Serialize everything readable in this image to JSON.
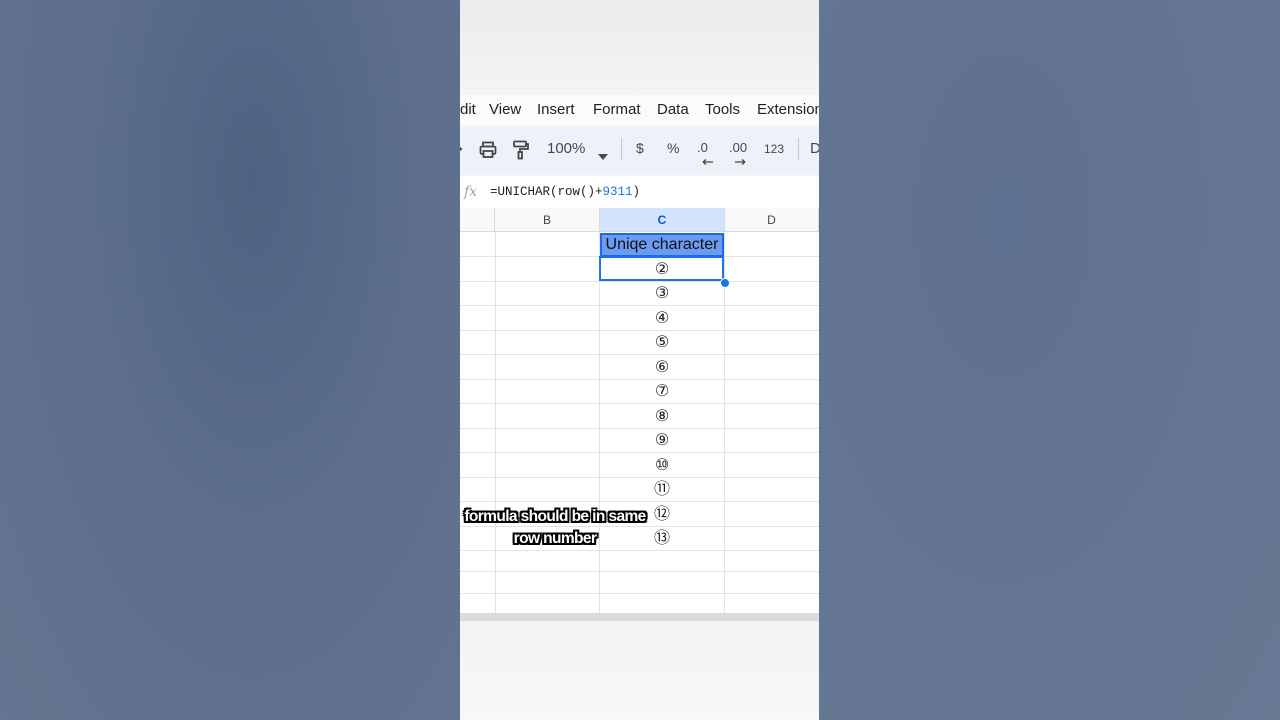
{
  "menu": [
    "dit",
    "View",
    "Insert",
    "Format",
    "Data",
    "Tools",
    "Extension"
  ],
  "toolbar": {
    "zoom": "100%",
    "currency": "$",
    "percent": "%",
    "decrease_decimal": ".0",
    "increase_decimal": ".00",
    "number_format": "123",
    "font_partial": "D"
  },
  "formula_bar": {
    "fx": "fx",
    "formula_prefix": "=UNICHAR(row()+",
    "formula_number": "9311",
    "formula_suffix": ")"
  },
  "columns": [
    "B",
    "C",
    "D"
  ],
  "selected_column": "C",
  "header_cell": "Uniqe character",
  "cells_c": [
    "②",
    "③",
    "④",
    "⑤",
    "⑥",
    "⑦",
    "⑧",
    "⑨",
    "⑩",
    "⑪",
    "⑫",
    "⑬"
  ],
  "caption": {
    "line1": "formula should be in same",
    "line2": "row number"
  },
  "colors": {
    "selection": "#1a73e8",
    "header_fill": "#6b9cf1",
    "background": "#5f718f"
  }
}
